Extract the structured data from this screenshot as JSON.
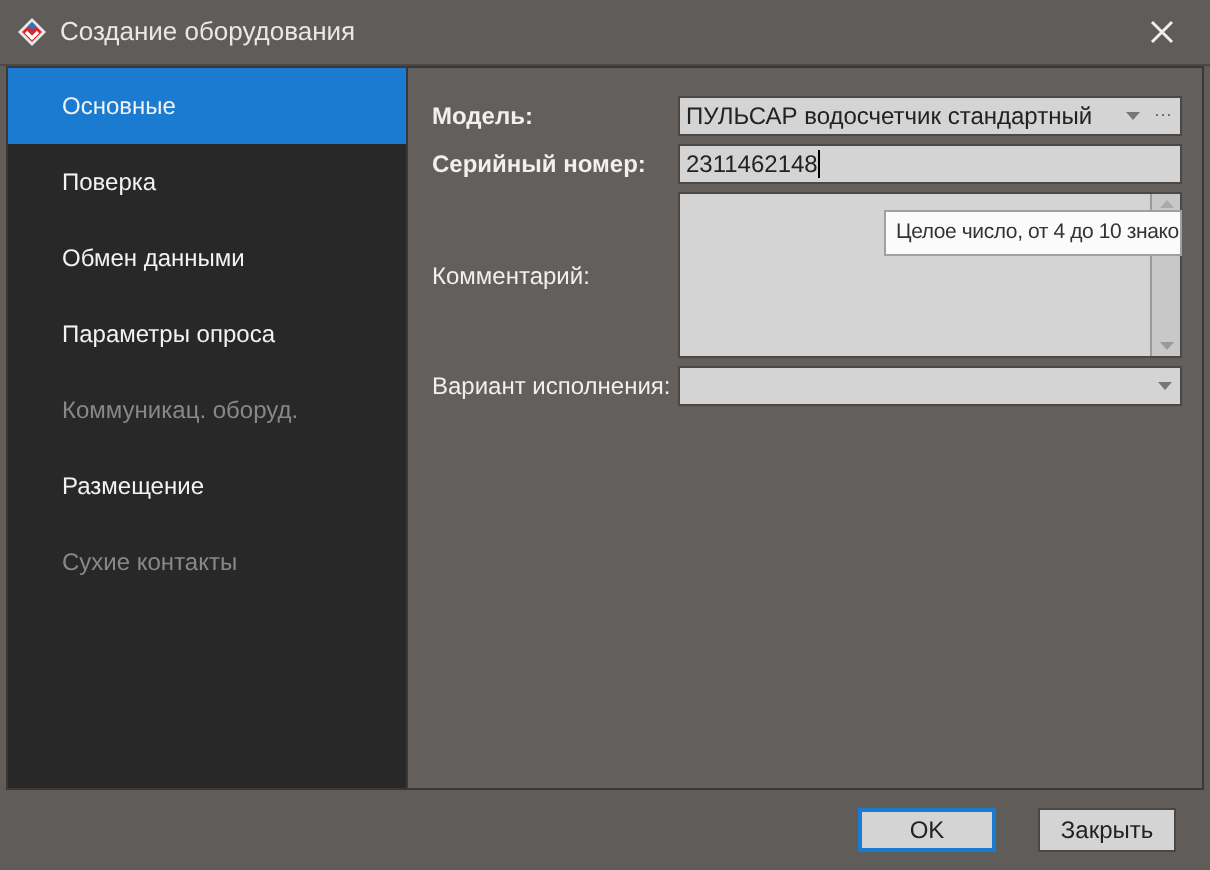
{
  "window": {
    "title": "Создание оборудования"
  },
  "sidebar": {
    "items": [
      {
        "label": "Основные",
        "selected": true,
        "disabled": false
      },
      {
        "label": "Поверка",
        "selected": false,
        "disabled": false
      },
      {
        "label": "Обмен данными",
        "selected": false,
        "disabled": false
      },
      {
        "label": "Параметры опроса",
        "selected": false,
        "disabled": false
      },
      {
        "label": "Коммуникац. оборуд.",
        "selected": false,
        "disabled": true
      },
      {
        "label": "Размещение",
        "selected": false,
        "disabled": false
      },
      {
        "label": "Сухие контакты",
        "selected": false,
        "disabled": true
      }
    ]
  },
  "form": {
    "fields": [
      {
        "kind": "combo",
        "label": "Модель:",
        "required": true,
        "value": "ПУЛЬСАР водосчетчик стандартный",
        "ellipsis": "···"
      },
      {
        "kind": "text",
        "label": "Серийный номер:",
        "required": true,
        "value": "2311462148",
        "focused": true
      },
      {
        "kind": "memo",
        "label": "Комментарий:",
        "required": false
      },
      {
        "kind": "dropdown",
        "label": "Вариант исполнения:",
        "required": false
      }
    ]
  },
  "tooltip": {
    "text": "Целое число, от 4 до 10 знако"
  },
  "buttons": [
    {
      "label": "OK",
      "default": true
    },
    {
      "label": "Закрыть",
      "default": false
    }
  ]
}
